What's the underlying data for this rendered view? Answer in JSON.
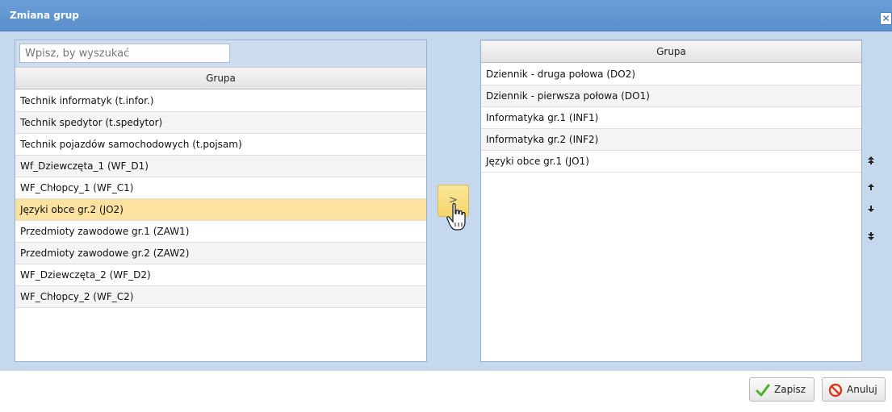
{
  "dialog": {
    "title": "Zmiana grup",
    "close_symbol": "✕"
  },
  "available": {
    "search_placeholder": "Wpisz, by wyszukać",
    "column_header": "Grupa",
    "items": [
      "Technik informatyk (t.infor.)",
      "Technik spedytor (t.spedytor)",
      "Technik pojazdów samochodowych (t.pojsam)",
      "Wf_Dziewczęta_1 (WF_D1)",
      "WF_Chłopcy_1 (WF_C1)",
      "Języki obce gr.2 (JO2)",
      "Przedmioty zawodowe gr.1 (ZAW1)",
      "Przedmioty zawodowe gr.2 (ZAW2)",
      "WF_Dziewczęta_2 (WF_D2)",
      "WF_Chłopcy_2 (WF_C2)"
    ],
    "selected_item": "Języki obce gr.2 (JO2)"
  },
  "move_button": {
    "label": ">"
  },
  "assigned": {
    "column_header": "Grupa",
    "items": [
      "Dziennik - druga połowa (DO2)",
      "Dziennik - pierwsza połowa (DO1)",
      "Informatyka gr.1 (INF1)",
      "Informatyka gr.2 (INF2)",
      "Języki obce gr.1 (JO1)"
    ]
  },
  "order_buttons": {
    "top_icon": "double-up-arrow-icon",
    "up_icon": "up-arrow-icon",
    "down_icon": "down-arrow-icon",
    "bottom_icon": "double-down-arrow-icon"
  },
  "footer": {
    "save_label": "Zapisz",
    "cancel_label": "Anuluj"
  },
  "colors": {
    "title_bar": "#5a8fcb",
    "selected_row": "#fbe2a1",
    "move_button": "#f5d56b"
  }
}
